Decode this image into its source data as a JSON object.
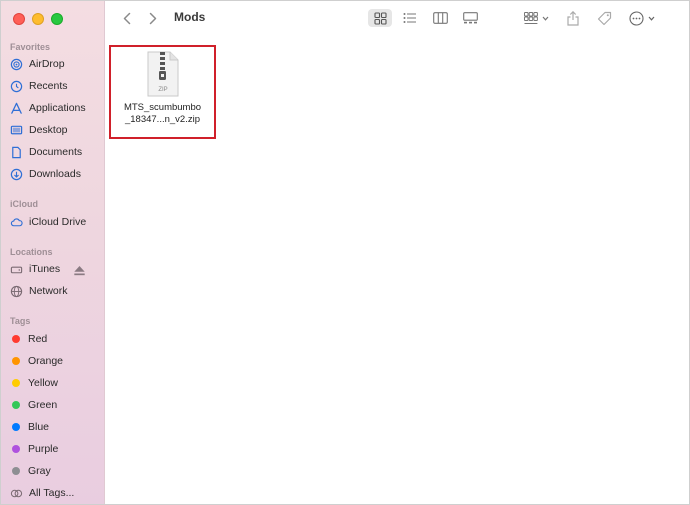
{
  "window": {
    "title": "Mods"
  },
  "sidebar": {
    "favorites_title": "Favorites",
    "favorites": [
      {
        "label": "AirDrop",
        "icon": "airdrop-icon"
      },
      {
        "label": "Recents",
        "icon": "clock-icon"
      },
      {
        "label": "Applications",
        "icon": "applications-icon"
      },
      {
        "label": "Desktop",
        "icon": "desktop-icon"
      },
      {
        "label": "Documents",
        "icon": "document-icon"
      },
      {
        "label": "Downloads",
        "icon": "download-icon"
      }
    ],
    "icloud_title": "iCloud",
    "icloud": [
      {
        "label": "iCloud Drive",
        "icon": "cloud-icon"
      }
    ],
    "locations_title": "Locations",
    "locations": [
      {
        "label": "iTunes",
        "icon": "drive-icon"
      },
      {
        "label": "Network",
        "icon": "globe-icon"
      }
    ],
    "tags_title": "Tags",
    "tags": [
      {
        "label": "Red",
        "color": "#ff3b30"
      },
      {
        "label": "Orange",
        "color": "#ff9500"
      },
      {
        "label": "Yellow",
        "color": "#ffcc00"
      },
      {
        "label": "Green",
        "color": "#34c759"
      },
      {
        "label": "Blue",
        "color": "#007aff"
      },
      {
        "label": "Purple",
        "color": "#af52de"
      },
      {
        "label": "Gray",
        "color": "#8e8e93"
      }
    ],
    "all_tags": "All Tags..."
  },
  "files": [
    {
      "name_line1": "MTS_scumbumbo",
      "name_line2": "_18347...n_v2.zip",
      "type_label": "ZIP",
      "selected": true
    }
  ],
  "colors": {
    "accent_red": "#d0202a",
    "sidebar_bg": "#efd7df"
  }
}
